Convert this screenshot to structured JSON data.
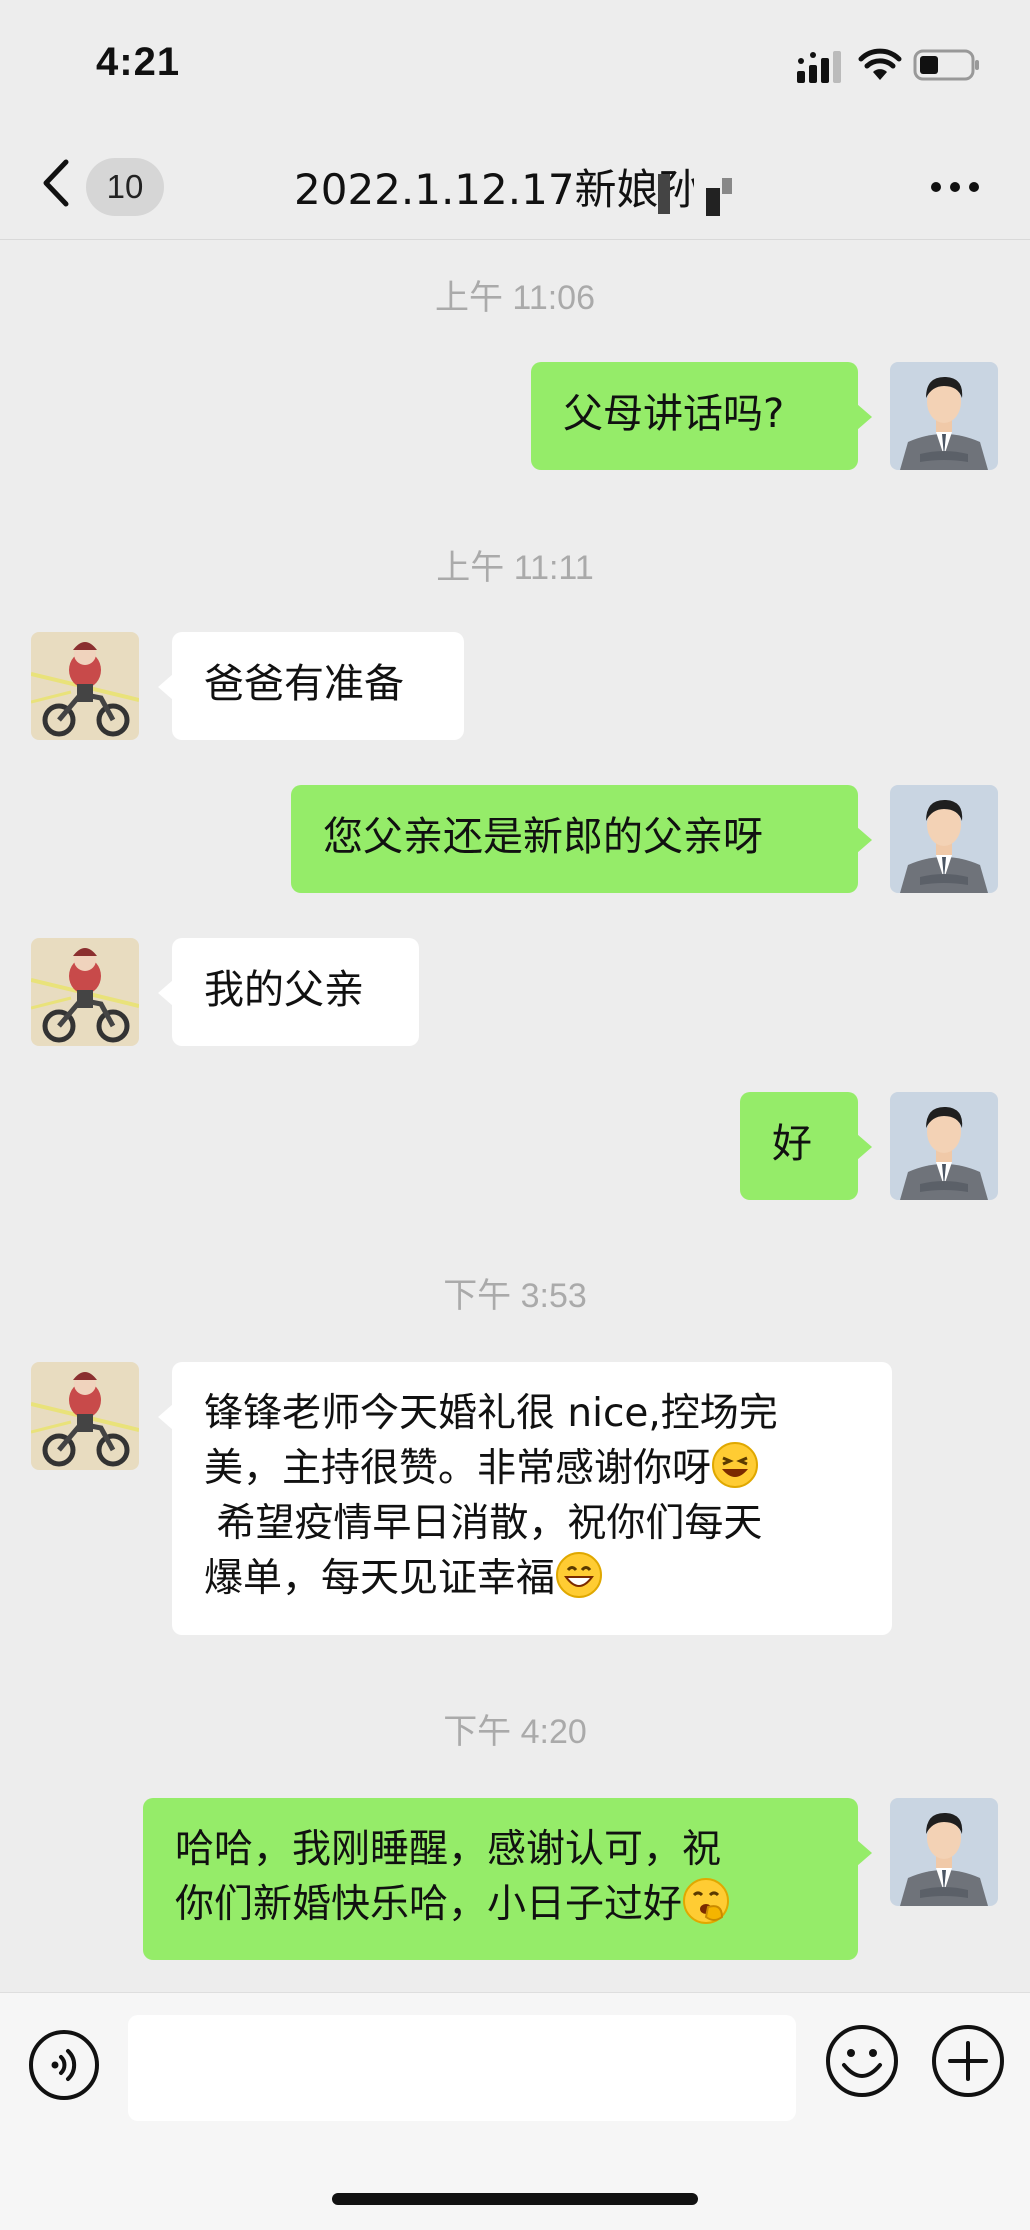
{
  "status_bar": {
    "time": "4:21"
  },
  "nav": {
    "back_count": "10",
    "title": "2022.1.12.17新娘孙"
  },
  "messages": [
    {
      "kind": "timestamp",
      "text": "上午 11:06"
    },
    {
      "kind": "message",
      "side": "me",
      "text": "父母讲话吗?"
    },
    {
      "kind": "timestamp",
      "text": "上午 11:11"
    },
    {
      "kind": "message",
      "side": "other",
      "text": "爸爸有准备"
    },
    {
      "kind": "message",
      "side": "me",
      "text": "您父亲还是新郎的父亲呀"
    },
    {
      "kind": "message",
      "side": "other",
      "text": "我的父亲"
    },
    {
      "kind": "message",
      "side": "me",
      "text": "好"
    },
    {
      "kind": "timestamp",
      "text": "下午 3:53"
    },
    {
      "kind": "message",
      "side": "other",
      "text_1": "锋锋老师今天婚礼很 nice,控场完\n美，主持很赞。非常感谢你呀",
      "emoji_1": "laughing-emoji",
      "text_2": "\n 希望疫情早日消散，祝你们每天\n爆单，每天见证幸福",
      "emoji_2": "grin-emoji"
    },
    {
      "kind": "timestamp",
      "text": "下午 4:20"
    },
    {
      "kind": "message",
      "side": "me",
      "text_1": "哈哈，我刚睡醒，感谢认可，祝\n你们新婚快乐哈，小日子过好",
      "emoji_1": "yawn-emoji"
    }
  ],
  "input_bar": {
    "placeholder": ""
  },
  "colors": {
    "my_bubble": "#95ec69",
    "other_bubble": "#ffffff",
    "background": "#ededed",
    "timestamp": "#aaaaaa"
  }
}
